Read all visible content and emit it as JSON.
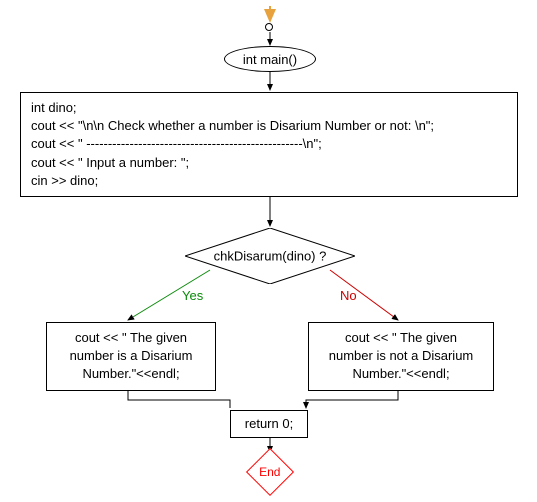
{
  "chart_data": {
    "type": "flowchart",
    "nodes": [
      {
        "id": "start",
        "type": "start",
        "label": ""
      },
      {
        "id": "main",
        "type": "process-ellipse",
        "label": "int main()"
      },
      {
        "id": "block1",
        "type": "process",
        "label_lines": [
          "int dino;",
          "cout << \"\\n\\n Check whether a number is Disarium Number or not: \\n\";",
          "cout << \" --------------------------------------------------\\n\";",
          "cout << \" Input a number: \";",
          "cin >> dino;"
        ]
      },
      {
        "id": "decision",
        "type": "decision",
        "label": "chkDisarum(dino) ?"
      },
      {
        "id": "yesBlock",
        "type": "process",
        "label_lines": [
          "cout << \" The given",
          "number is a Disarium",
          "Number.\"<<endl;"
        ]
      },
      {
        "id": "noBlock",
        "type": "process",
        "label_lines": [
          "cout << \" The given",
          "number is not a Disarium",
          "Number.\"<<endl;"
        ]
      },
      {
        "id": "return",
        "type": "process",
        "label": "return 0;"
      },
      {
        "id": "end",
        "type": "end",
        "label": "End"
      }
    ],
    "edges": [
      {
        "from": "start",
        "to": "main"
      },
      {
        "from": "main",
        "to": "block1"
      },
      {
        "from": "block1",
        "to": "decision"
      },
      {
        "from": "decision",
        "to": "yesBlock",
        "label": "Yes"
      },
      {
        "from": "decision",
        "to": "noBlock",
        "label": "No"
      },
      {
        "from": "yesBlock",
        "to": "return"
      },
      {
        "from": "noBlock",
        "to": "return"
      },
      {
        "from": "return",
        "to": "end"
      }
    ]
  },
  "nodes": {
    "main": "int main()",
    "block1_l1": "int dino;",
    "block1_l2": "cout << \"\\n\\n Check whether a number is Disarium Number or not: \\n\";",
    "block1_l3": "cout << \" --------------------------------------------------\\n\";",
    "block1_l4": "cout << \" Input a number: \";",
    "block1_l5": "cin >> dino;",
    "decision": "chkDisarum(dino) ?",
    "yes_l1": "cout << \" The given",
    "yes_l2": "number is a Disarium",
    "yes_l3": "Number.\"<<endl;",
    "no_l1": "cout << \" The given",
    "no_l2": "number is not a Disarium",
    "no_l3": "Number.\"<<endl;",
    "return": "return 0;",
    "end": "End"
  },
  "labels": {
    "yes": "Yes",
    "no": "No"
  }
}
